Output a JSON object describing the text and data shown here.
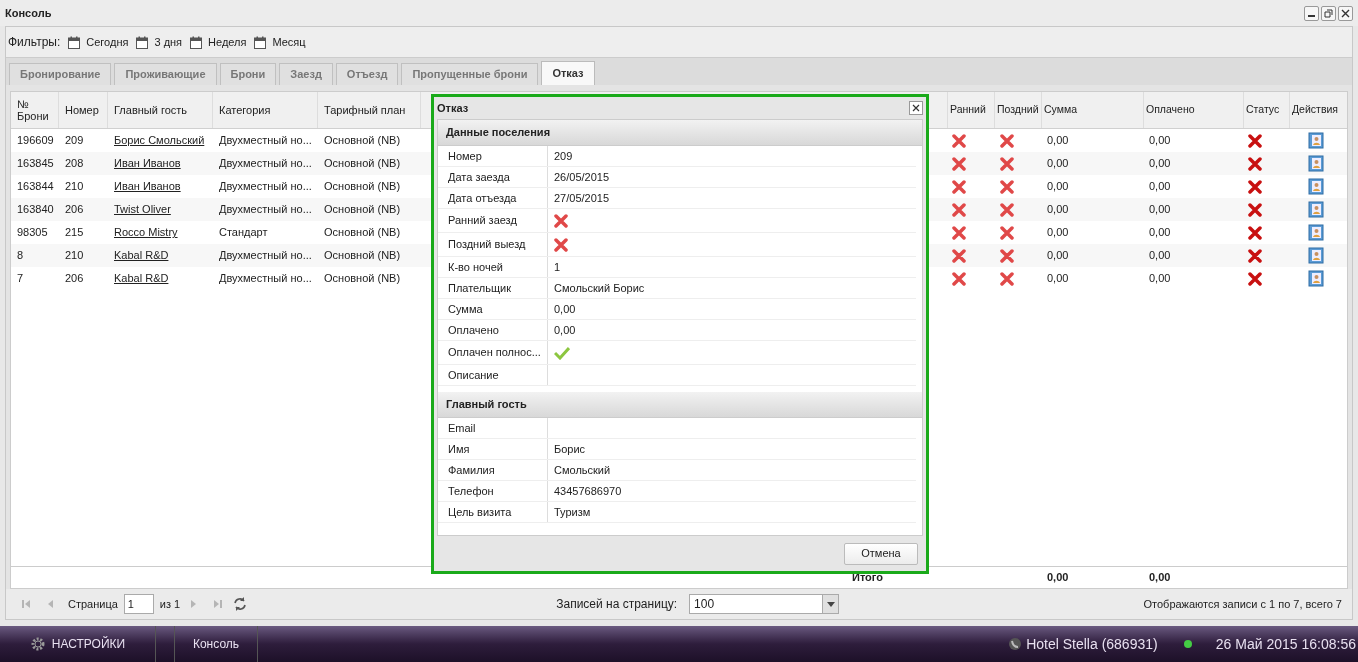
{
  "window": {
    "title": "Консоль"
  },
  "filters": {
    "label": "Фильтры:",
    "items": [
      "Сегодня",
      "3 дня",
      "Неделя",
      "Месяц"
    ]
  },
  "tabs": [
    {
      "label": "Бронирование",
      "selected": false
    },
    {
      "label": "Проживающие",
      "selected": false
    },
    {
      "label": "Брони",
      "selected": false
    },
    {
      "label": "Заезд",
      "selected": false
    },
    {
      "label": "Отъезд",
      "selected": false
    },
    {
      "label": "Пропущенные брони",
      "selected": false
    },
    {
      "label": "Отказ",
      "selected": true
    }
  ],
  "table": {
    "columns_left": [
      "№ Брони",
      "Номер",
      "Главный гость",
      "Категория",
      "Тарифный план"
    ],
    "columns_right": [
      "Ранний",
      "Поздний",
      "Сумма",
      "Оплачено",
      "Статус",
      "Действия"
    ],
    "rows": [
      {
        "booking": "196609",
        "room": "209",
        "guest": "Борис Смольский",
        "category": "Двухместный но...",
        "rate": "Основной (NB)",
        "early": false,
        "late": false,
        "sum": "0,00",
        "paid": "0,00",
        "status_ok": false
      },
      {
        "booking": "163845",
        "room": "208",
        "guest": "Иван Иванов",
        "category": "Двухместный но...",
        "rate": "Основной (NB)",
        "early": false,
        "late": false,
        "sum": "0,00",
        "paid": "0,00",
        "status_ok": false
      },
      {
        "booking": "163844",
        "room": "210",
        "guest": "Иван Иванов",
        "category": "Двухместный но...",
        "rate": "Основной (NB)",
        "early": false,
        "late": false,
        "sum": "0,00",
        "paid": "0,00",
        "status_ok": false
      },
      {
        "booking": "163840",
        "room": "206",
        "guest": "Twist Oliver",
        "category": "Двухместный но...",
        "rate": "Основной (NB)",
        "early": false,
        "late": false,
        "sum": "0,00",
        "paid": "0,00",
        "status_ok": false
      },
      {
        "booking": "98305",
        "room": "215",
        "guest": "Rocco Mistry",
        "category": "Стандарт",
        "rate": "Основной (NB)",
        "early": false,
        "late": false,
        "sum": "0,00",
        "paid": "0,00",
        "status_ok": false
      },
      {
        "booking": "8",
        "room": "210",
        "guest": "Kabal R&D",
        "category": "Двухместный но...",
        "rate": "Основной (NB)",
        "early": false,
        "late": false,
        "sum": "0,00",
        "paid": "0,00",
        "status_ok": false
      },
      {
        "booking": "7",
        "room": "206",
        "guest": "Kabal R&D",
        "category": "Двухместный но...",
        "rate": "Основной (NB)",
        "early": false,
        "late": false,
        "sum": "0,00",
        "paid": "0,00",
        "status_ok": false
      }
    ],
    "totals": {
      "label": "Итого",
      "sum": "0,00",
      "paid": "0,00"
    }
  },
  "paging": {
    "page_label": "Страница",
    "page": "1",
    "of": "из 1",
    "per_page_label": "Записей на страницу:",
    "per_page": "100",
    "summary": "Отображаются записи с 1 по 7, всего 7"
  },
  "dialog": {
    "title": "Отказ",
    "sections": [
      {
        "title": "Данные поселения",
        "fields": [
          {
            "label": "Номер",
            "kind": "text",
            "value": "209"
          },
          {
            "label": "Дата заезда",
            "kind": "text",
            "value": "26/05/2015"
          },
          {
            "label": "Дата отъезда",
            "kind": "text",
            "value": "27/05/2015"
          },
          {
            "label": "Ранний заезд",
            "kind": "flag",
            "checked": false
          },
          {
            "label": "Поздний выезд",
            "kind": "flag",
            "checked": false
          },
          {
            "label": "К-во ночей",
            "kind": "text",
            "value": "1"
          },
          {
            "label": "Плательщик",
            "kind": "text",
            "value": "Смольский Борис"
          },
          {
            "label": "Сумма",
            "kind": "text",
            "value": "0,00"
          },
          {
            "label": "Оплачено",
            "kind": "text",
            "value": "0,00"
          },
          {
            "label": "Оплачен полнос...",
            "kind": "flag",
            "checked": true
          },
          {
            "label": "Описание",
            "kind": "text"
          }
        ]
      },
      {
        "title": "Главный гость",
        "fields": [
          {
            "label": "Email",
            "kind": "text"
          },
          {
            "label": "Имя",
            "kind": "text",
            "value": "Борис"
          },
          {
            "label": "Фамилия",
            "kind": "text",
            "value": "Смольский"
          },
          {
            "label": "Телефон",
            "kind": "text",
            "value": "43457686970"
          },
          {
            "label": "Цель визита",
            "kind": "text",
            "value": "Туризм"
          }
        ]
      }
    ],
    "cancel": "Отмена"
  },
  "taskbar": {
    "settings": "НАСТРОЙКИ",
    "window": "Консоль",
    "hotel": "Hotel Stella (686931)",
    "online": true,
    "datetime": "26 Май 2015 16:08:56"
  }
}
